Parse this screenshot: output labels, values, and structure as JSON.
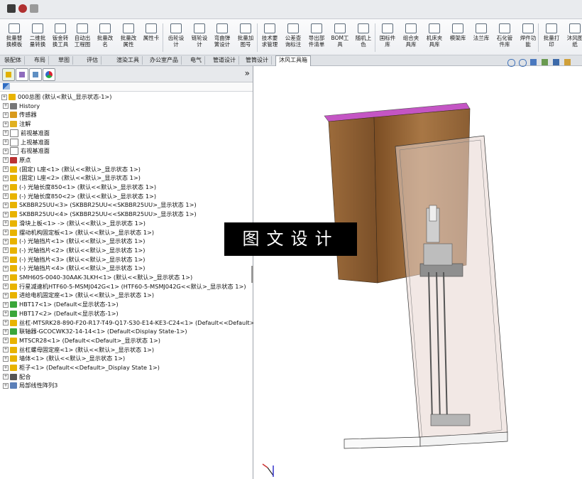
{
  "ribbon": {
    "buttons": [
      "批量替\n换模板",
      "二维批\n量转换",
      "钣金转\n换工具",
      "自动出\n工程图",
      "批量改\n名",
      "批量改\n属性",
      "属性卡",
      "齿轮设\n计",
      "链轮设\n计",
      "弯曲弹\n簧设计",
      "批量加\n图号",
      "技术要\n求管理",
      "公差查\n询标注",
      "导出部\n件清单",
      "BOM工\n具",
      "随机上\n色",
      "国标件\n库",
      "组合夹\n具库",
      "机床夹\n具库",
      "模架库",
      "法兰库",
      "石化管\n件库",
      "焊件功\n能",
      "批量打\n印",
      "沐风图\n纸"
    ]
  },
  "tabs": [
    "装配体",
    "布局",
    "草图",
    "评估",
    "渲染工具",
    "办公室产品",
    "电气",
    "管道设计",
    "管筒设计",
    "沐风工具箱"
  ],
  "active_tab": "沐风工具箱",
  "panel": {
    "expand_label": "»",
    "tree": [
      {
        "label": "000总图 (默认<默认_显示状态-1>)",
        "indent": 0,
        "icon": "assembly-icon"
      },
      {
        "label": "History",
        "indent": 1,
        "icon": "history-icon"
      },
      {
        "label": "传感器",
        "indent": 1,
        "icon": "sensor-icon"
      },
      {
        "label": "注解",
        "indent": 1,
        "icon": "annotation-icon"
      },
      {
        "label": "前视基准面",
        "indent": 1,
        "icon": "plane-icon"
      },
      {
        "label": "上视基准面",
        "indent": 1,
        "icon": "plane-icon"
      },
      {
        "label": "右视基准面",
        "indent": 1,
        "icon": "plane-icon"
      },
      {
        "label": "原点",
        "indent": 1,
        "icon": "origin-icon"
      },
      {
        "label": "(固定) L座<1> (默认<<默认>_显示状态 1>)",
        "indent": 1,
        "icon": "part-icon"
      },
      {
        "label": "(固定) L座<2> (默认<<默认>_显示状态 1>)",
        "indent": 1,
        "icon": "part-icon"
      },
      {
        "label": "(-) 光轴长度850<1> (默认<<默认>_显示状态 1>)",
        "indent": 1,
        "icon": "part-icon"
      },
      {
        "label": "(-) 光轴长度850<2> (默认<<默认>_显示状态 1>)",
        "indent": 1,
        "icon": "part-icon"
      },
      {
        "label": "SKBBR25UU<3> (SKBBR25UU<<SKBBR25UU>_显示状态 1>)",
        "indent": 1,
        "icon": "part-icon"
      },
      {
        "label": "SKBBR25UU<4> (SKBBR25UU<<SKBBR25UU>_显示状态 1>)",
        "indent": 1,
        "icon": "part-icon"
      },
      {
        "label": "滑块上板<1> -> (默认<<默认>_显示状态 1>)",
        "indent": 1,
        "icon": "part-icon"
      },
      {
        "label": "摆动机构固定板<1> (默认<<默认>_显示状态 1>)",
        "indent": 1,
        "icon": "part-icon"
      },
      {
        "label": "(-) 光轴挡片<1> (默认<<默认>_显示状态 1>)",
        "indent": 1,
        "icon": "part-icon"
      },
      {
        "label": "(-) 光轴挡片<2> (默认<<默认>_显示状态 1>)",
        "indent": 1,
        "icon": "part-icon"
      },
      {
        "label": "(-) 光轴挡片<3> (默认<<默认>_显示状态 1>)",
        "indent": 1,
        "icon": "part-icon"
      },
      {
        "label": "(-) 光轴挡片<4> (默认<<默认>_显示状态 1>)",
        "indent": 1,
        "icon": "part-icon"
      },
      {
        "label": "SMH60S-0040-30AAK-3LKH<1> (默认<<默认>_显示状态 1>)",
        "indent": 1,
        "icon": "part-icon"
      },
      {
        "label": "行星减速机HTF60-5-MSMJ042G<1> (HTF60-5-MSMJ042G<<默认>_显示状态 1>)",
        "indent": 1,
        "icon": "part-icon"
      },
      {
        "label": "进给电机固定座<1> (默认<<默认>_显示状态 1>)",
        "indent": 1,
        "icon": "part-icon"
      },
      {
        "label": "HBT17<1> (Default<显示状态-1>)",
        "indent": 1,
        "icon": "subassembly-icon"
      },
      {
        "label": "HBT17<2> (Default<显示状态-1>)",
        "indent": 1,
        "icon": "subassembly-icon"
      },
      {
        "label": "丝杠-MTSRK28-890-F20-R17-T49-Q17-S30-E14-KE3-C24<1> (Default<<Default>",
        "indent": 1,
        "icon": "part-icon"
      },
      {
        "label": "联轴器-GCOCWK32-14-14<1> (Default<Display State-1>)",
        "indent": 1,
        "icon": "subassembly-icon"
      },
      {
        "label": "MTSCR28<1> (Default<<Default>_显示状态 1>)",
        "indent": 1,
        "icon": "part-icon"
      },
      {
        "label": "丝杠螺母固定座<1> (默认<<默认>_显示状态 1>)",
        "indent": 1,
        "icon": "part-icon"
      },
      {
        "label": "墙体<1> (默认<<默认>_显示状态 1>)",
        "indent": 1,
        "icon": "part-icon"
      },
      {
        "label": "柜子<1> (Default<<Default>_Display State 1>)",
        "indent": 1,
        "icon": "part-icon"
      },
      {
        "label": "配合",
        "indent": 1,
        "icon": "mates-icon"
      },
      {
        "label": "局部线性阵列3",
        "indent": 1,
        "icon": "pattern-icon"
      }
    ]
  },
  "watermark": "图文设计",
  "colors": {
    "cabinet_top": "#c455c4",
    "cabinet_wood": "#9b6a3c",
    "glass": "#e9d8d2",
    "part_yellow": "#e8b300",
    "part_green": "#3aa63a"
  }
}
